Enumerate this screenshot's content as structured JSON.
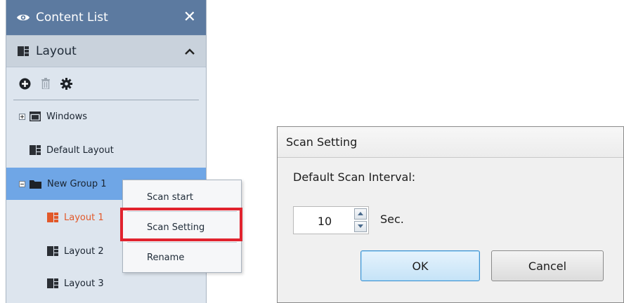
{
  "panel": {
    "title": "Content List",
    "section_title": "Layout",
    "tree": [
      {
        "label": "Windows"
      },
      {
        "label": "Default Layout"
      },
      {
        "label": "New Group 1"
      },
      {
        "label": "Layout 1"
      },
      {
        "label": "Layout 2"
      },
      {
        "label": "Layout 3"
      }
    ]
  },
  "context_menu": {
    "items": [
      "Scan start",
      "Scan Setting",
      "Rename"
    ]
  },
  "dialog": {
    "title": "Scan Setting",
    "interval_label": "Default Scan Interval:",
    "interval_value": "10",
    "unit": "Sec.",
    "ok_label": "OK",
    "cancel_label": "Cancel"
  },
  "colors": {
    "titlebar": "#5c7aa0",
    "selected_row": "#6fa6e6",
    "active_layout": "#e2592a",
    "highlight_box": "#e1232e"
  }
}
